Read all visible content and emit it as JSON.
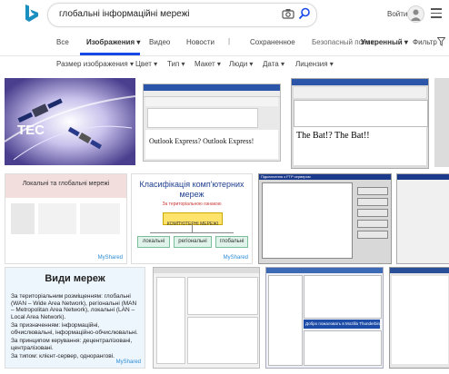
{
  "header": {
    "search_query": "глобальні інформаційні мережі",
    "signin_label": "Войти"
  },
  "nav": {
    "tabs": [
      {
        "label": "Все"
      },
      {
        "label": "Изображения ▾"
      },
      {
        "label": "Видео"
      },
      {
        "label": "Новости"
      }
    ],
    "separator": "|",
    "saved": "Сохраненное",
    "safesearch_label": "Безопасный поиск:",
    "safesearch_value": "Умеренный ▾",
    "filter_label": "Фильтр"
  },
  "filters": [
    {
      "label": "Размер изображения ▾"
    },
    {
      "label": "Цвет ▾"
    },
    {
      "label": "Тип ▾"
    },
    {
      "label": "Макет ▾"
    },
    {
      "label": "Люди ▾"
    },
    {
      "label": "Дата ▾"
    },
    {
      "label": "Лицензия ▾"
    }
  ],
  "results": {
    "r1": {
      "label": "TEC"
    },
    "r2": {
      "title": "Outlook Express? Outlook Express!"
    },
    "r3": {
      "title": "The Bat!? The Bat!!"
    },
    "r4": {
      "title": "Локальні та глобальні мережі",
      "watermark": "MyShared"
    },
    "r5": {
      "title": "Класифікація комп'ютерних мереж",
      "subtitle": "За територіальною ознакою",
      "root": "КОМП'ЮТЕРНІ МЕРЕЖІ",
      "leaves": [
        "локальні",
        "регіональні",
        "глобальні"
      ],
      "watermark": "MyShared"
    },
    "r6": {
      "title": "Підключення з FTP сервером"
    },
    "r8": {
      "title": "Види мереж",
      "items": [
        "За територіальним розміщенням: глобальні (WAN – Wide Area Network), регіональні (MAN – Metropolitan Area Network), локальні (LAN – Local Area Network).",
        "За призначенням: інформаційні, обчислювальні, інформаційно-обчислювальні.",
        "За принципом керування: децентралізовані, централізовані.",
        "За типом: клієнт-сервер, однорангові."
      ],
      "watermark": "MyShared"
    },
    "r10": {
      "title": "Добро пожаловать в Mozilla Thunderbird"
    }
  }
}
